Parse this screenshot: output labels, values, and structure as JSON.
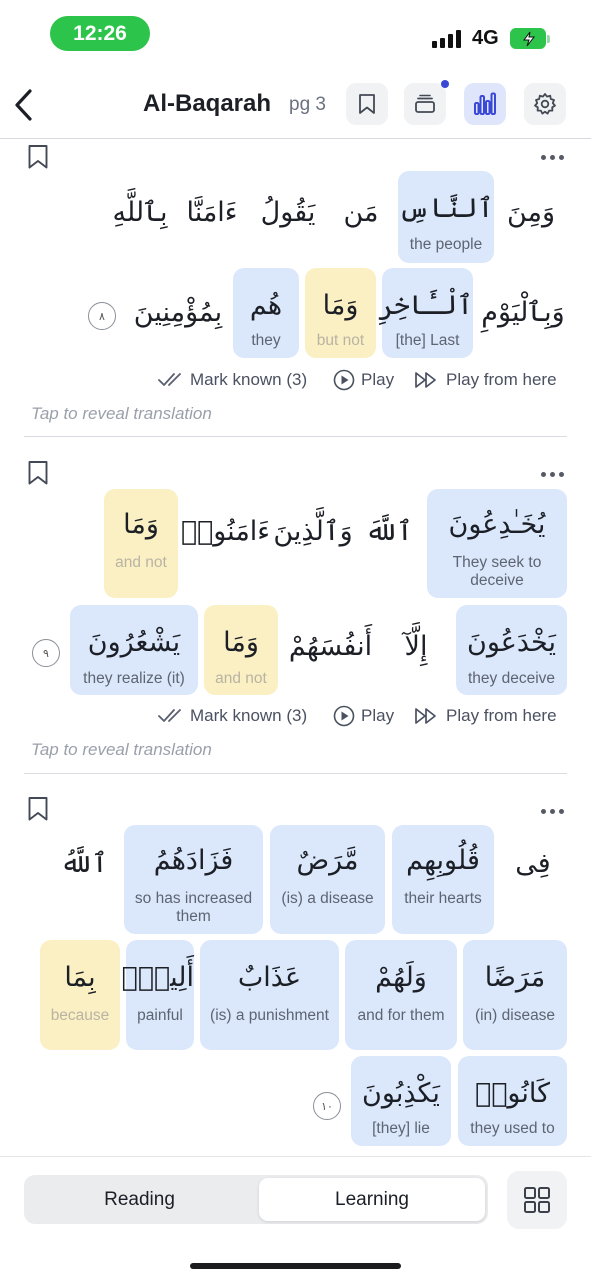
{
  "status_bar": {
    "time": "12:26",
    "network": "4G"
  },
  "header": {
    "title": "Al-Baqarah",
    "page": "pg 3"
  },
  "actions": {
    "mark_known": "Mark known (3)",
    "play": "Play",
    "play_from_here": "Play from here"
  },
  "reveal_hint": "Tap to reveal translation",
  "verses": [
    {
      "number": "٨",
      "words": [
        {
          "ar": "وَمِنَ",
          "tr": ""
        },
        {
          "ar": "ٱلنَّاسِ",
          "tr": "the people"
        },
        {
          "ar": "مَن",
          "tr": ""
        },
        {
          "ar": "يَقُولُ",
          "tr": ""
        },
        {
          "ar": "ءَامَنَّا",
          "tr": ""
        },
        {
          "ar": "بِٱللَّهِ",
          "tr": ""
        },
        {
          "ar": "وَبِٱلْيَوْمِ",
          "tr": ""
        },
        {
          "ar": "ٱلْـَٔاخِرِ",
          "tr": "[the] Last"
        },
        {
          "ar": "وَمَا",
          "tr": "but not"
        },
        {
          "ar": "هُم",
          "tr": "they"
        },
        {
          "ar": "بِمُؤْمِنِينَ",
          "tr": ""
        }
      ]
    },
    {
      "number": "٩",
      "words": [
        {
          "ar": "يُخَـٰدِعُونَ",
          "tr": "They seek to deceive"
        },
        {
          "ar": "ٱللَّهَ",
          "tr": ""
        },
        {
          "ar": "وَٱلَّذِينَ",
          "tr": ""
        },
        {
          "ar": "ءَامَنُوا۟",
          "tr": ""
        },
        {
          "ar": "وَمَا",
          "tr": "and not"
        },
        {
          "ar": "يَخْدَعُونَ",
          "tr": "they deceive"
        },
        {
          "ar": "إِلَّآ",
          "tr": ""
        },
        {
          "ar": "أَنفُسَهُمْ",
          "tr": ""
        },
        {
          "ar": "وَمَا",
          "tr": "and not"
        },
        {
          "ar": "يَشْعُرُونَ",
          "tr": "they realize (it)"
        }
      ]
    },
    {
      "number": "١٠",
      "words": [
        {
          "ar": "فِى",
          "tr": ""
        },
        {
          "ar": "قُلُوبِهِم",
          "tr": "their hearts"
        },
        {
          "ar": "مَّرَضٌ",
          "tr": "(is) a disease"
        },
        {
          "ar": "فَزَادَهُمُ",
          "tr": "so has increased them"
        },
        {
          "ar": "ٱللَّهُ",
          "tr": ""
        },
        {
          "ar": "مَرَضًا",
          "tr": "(in) disease"
        },
        {
          "ar": "وَلَهُمْ",
          "tr": "and for them"
        },
        {
          "ar": "عَذَابٌ",
          "tr": "(is) a punishment"
        },
        {
          "ar": "أَلِيمٌۢ",
          "tr": "painful"
        },
        {
          "ar": "بِمَا",
          "tr": "because"
        },
        {
          "ar": "كَانُوا۟",
          "tr": "they used to"
        },
        {
          "ar": "يَكْذِبُونَ",
          "tr": "[they] lie"
        }
      ]
    }
  ],
  "bottom": {
    "tab_reading": "Reading",
    "tab_learning": "Learning",
    "selected_tab": "Learning"
  },
  "colors": {
    "known_word": "#dbe8fb",
    "particle_word": "#fbf0c3",
    "accent": "#3a48d6",
    "status_green": "#2cc44a"
  },
  "icons": [
    "back-chevron-icon",
    "bookmark-icon",
    "layers-icon",
    "bar-chart-icon",
    "gear-icon",
    "more-dots-icon",
    "double-check-icon",
    "play-circle-icon",
    "play-from-here-icon",
    "grid-icon"
  ]
}
